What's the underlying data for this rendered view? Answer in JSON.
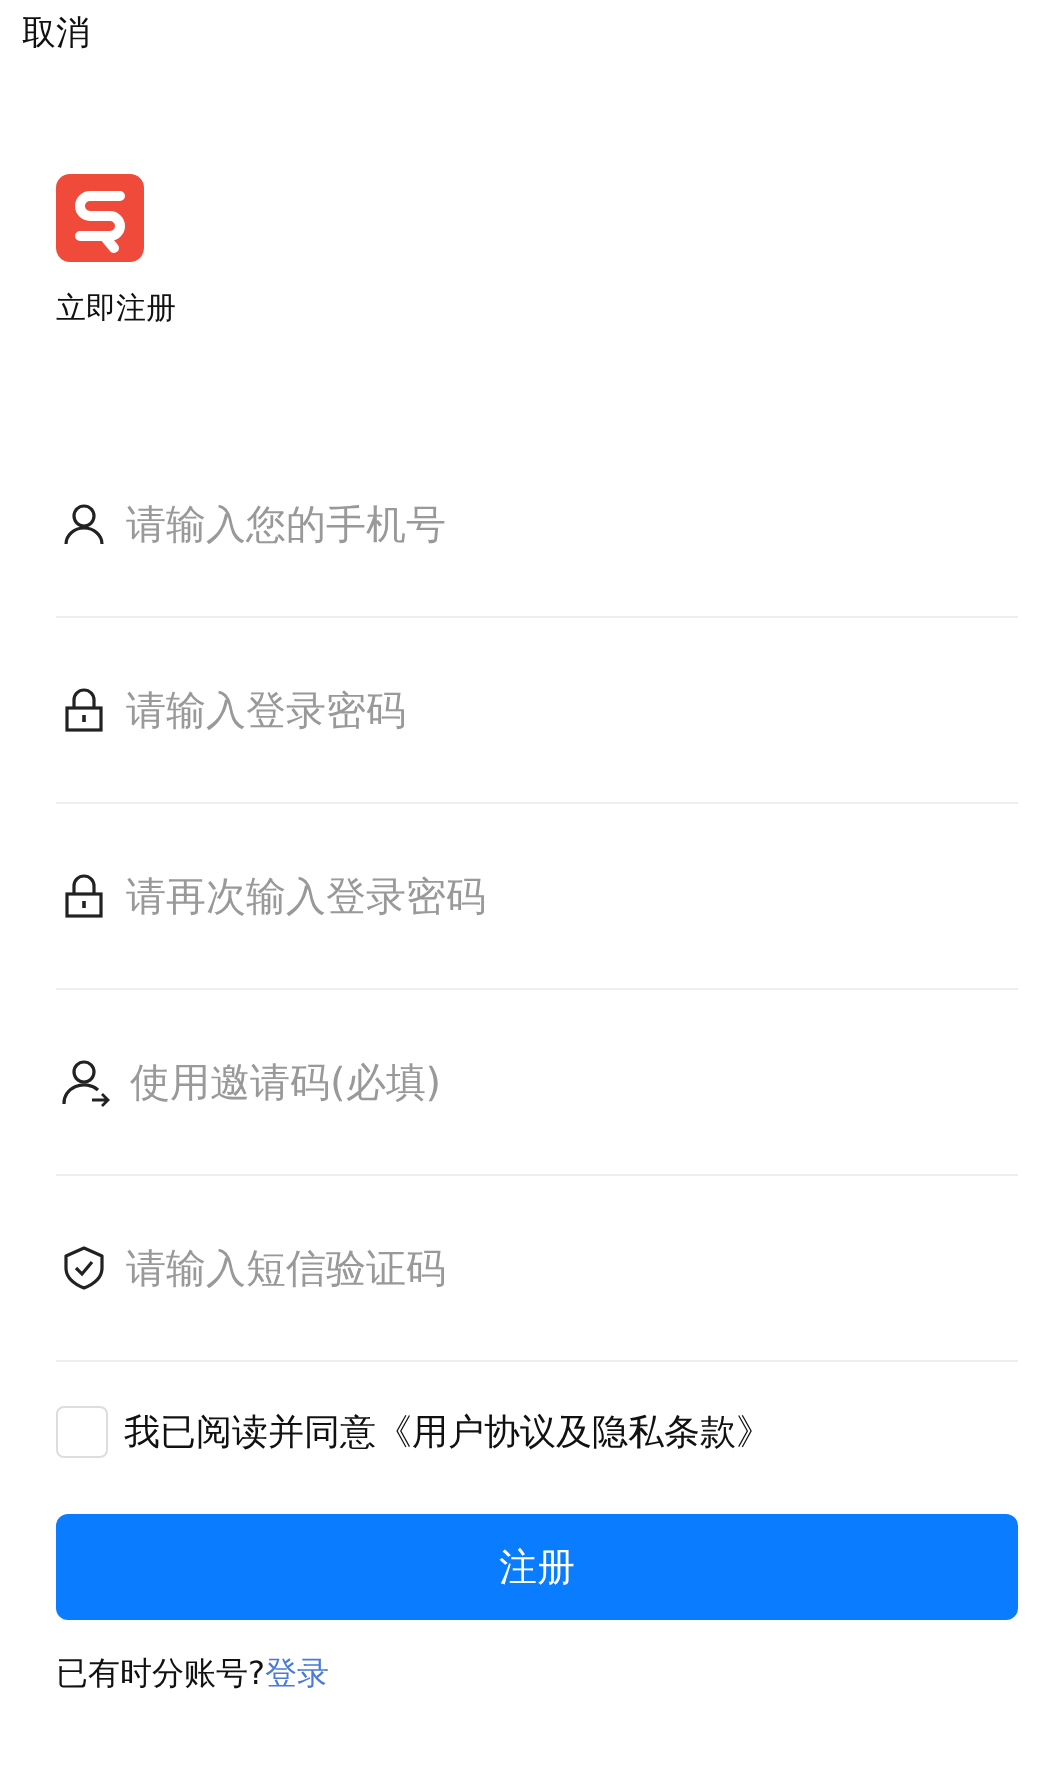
{
  "cancel": "取消",
  "title": "立即注册",
  "fields": [
    {
      "kind": "person",
      "placeholder": "请输入您的手机号"
    },
    {
      "kind": "lock",
      "placeholder": "请输入登录密码"
    },
    {
      "kind": "lock",
      "placeholder": "请再次输入登录密码"
    },
    {
      "kind": "invite",
      "placeholder": "使用邀请码(必填)"
    },
    {
      "kind": "shield",
      "placeholder": "请输入短信验证码"
    }
  ],
  "agreement": {
    "checked": false,
    "label": "我已阅读并同意《用户协议及隐私条款》"
  },
  "submit": "注册",
  "footer": {
    "text": "已有时分账号?",
    "link": "登录"
  }
}
